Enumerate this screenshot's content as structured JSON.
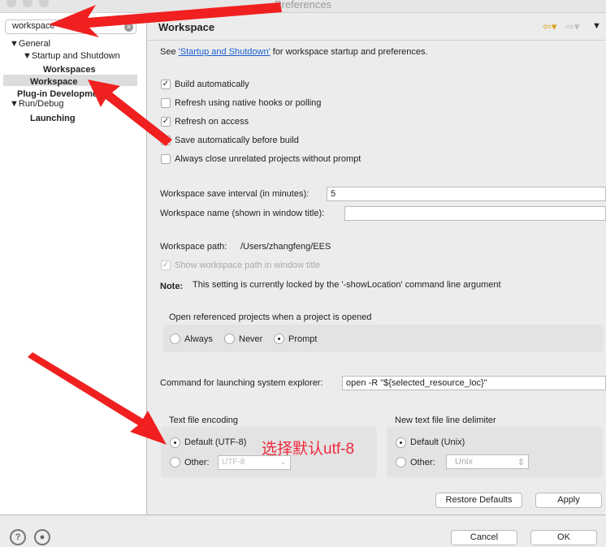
{
  "window": {
    "title": "Preferences"
  },
  "sidebar": {
    "search_value": "workspace",
    "tree": [
      "General",
      "Startup and Shutdown",
      "Workspaces",
      "Workspace",
      "Plug-in Development",
      "Run/Debug",
      "Launching"
    ]
  },
  "page": {
    "title": "Workspace",
    "intro_pre": "See ",
    "intro_link": "'Startup and Shutdown'",
    "intro_post": " for workspace startup and preferences.",
    "checkboxes": [
      {
        "label": "Build automatically",
        "checked": true
      },
      {
        "label": "Refresh using native hooks or polling",
        "checked": false
      },
      {
        "label": "Refresh on access",
        "checked": true
      },
      {
        "label": "Save automatically before build",
        "checked": false
      },
      {
        "label": "Always close unrelated projects without prompt",
        "checked": false
      }
    ],
    "save_interval_label": "Workspace save interval (in minutes):",
    "save_interval_value": "5",
    "name_label": "Workspace name (shown in window title):",
    "name_value": "",
    "path_label": "Workspace path:",
    "path_value": "/Users/zhangfeng/EES",
    "show_path_label": "Show workspace path in window title",
    "note_label": "Note:",
    "note_text": "This setting is currently locked by the '-showLocation' command line argument",
    "open_ref_label": "Open referenced projects when a project is opened",
    "open_ref_options": [
      "Always",
      "Never",
      "Prompt"
    ],
    "open_ref_selected": "Prompt",
    "explorer_label": "Command for launching system explorer:",
    "explorer_value": "open -R \"${selected_resource_loc}\"",
    "encoding": {
      "label": "Text file encoding",
      "default": "Default (UTF-8)",
      "other": "Other:",
      "other_value": "UTF-8",
      "selected": "default"
    },
    "delimiter": {
      "label": "New text file line delimiter",
      "default": "Default (Unix)",
      "other": "Other:",
      "other_value": "Unix",
      "selected": "default"
    },
    "restore_defaults": "Restore Defaults",
    "apply": "Apply"
  },
  "annotation": {
    "text": "选择默认utf-8",
    "color": "#f0283c"
  },
  "footer": {
    "cancel": "Cancel",
    "ok": "OK"
  }
}
